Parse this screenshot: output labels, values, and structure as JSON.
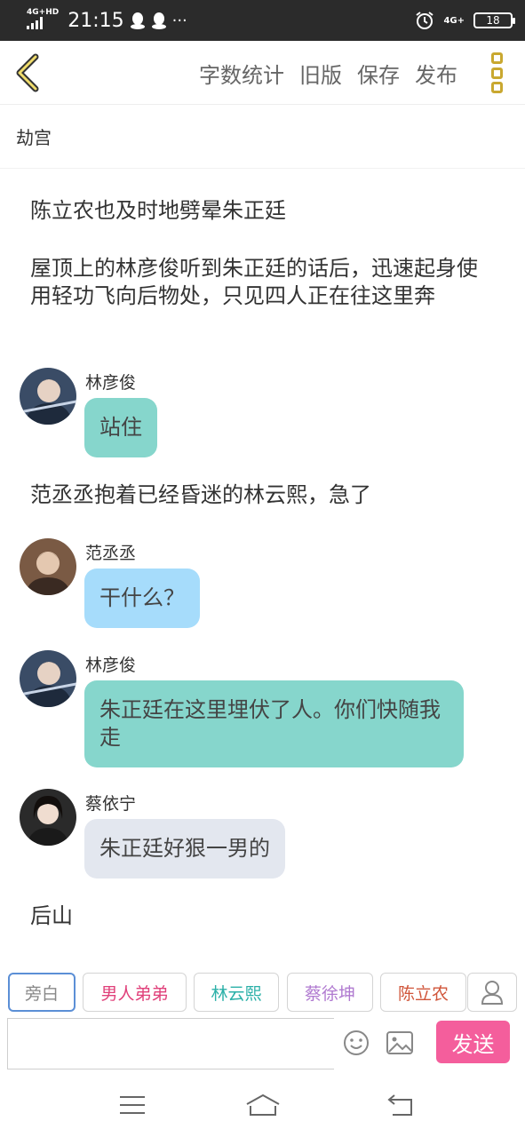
{
  "status_bar": {
    "network": "4G+HD",
    "time": "21:15",
    "signal": "4G+",
    "battery": "18",
    "more": "···"
  },
  "toolbar": {
    "items": [
      "字数统计",
      "旧版",
      "保存",
      "发布"
    ]
  },
  "title": "劫宫",
  "messages": [
    {
      "type": "narration",
      "text": "陈立农也及时地劈晕朱正廷"
    },
    {
      "type": "narration",
      "text": "屋顶上的林彦俊听到朱正廷的话后，迅速起身使用轻功飞向后物处，只见四人正在往这里奔"
    },
    {
      "type": "dialog",
      "speaker": "林彦俊",
      "text": "站住",
      "color": "#86d6cc"
    },
    {
      "type": "narration",
      "text": "范丞丞抱着已经昏迷的林云熙，急了"
    },
    {
      "type": "dialog",
      "speaker": "范丞丞",
      "text": "干什么？",
      "color": "#a6dcfb"
    },
    {
      "type": "dialog",
      "speaker": "林彦俊",
      "text": "朱正廷在这里埋伏了人。你们快随我走",
      "color": "#86d6cc"
    },
    {
      "type": "dialog",
      "speaker": "蔡依宁",
      "text": "朱正廷好狠一男的",
      "color": "#e3e7ef"
    },
    {
      "type": "narration",
      "text": "后山"
    }
  ],
  "roles": [
    {
      "label": "旁白",
      "color": "#888888"
    },
    {
      "label": "男人弟弟",
      "color": "#e0407a"
    },
    {
      "label": "林云熙",
      "color": "#2bb0a8"
    },
    {
      "label": "蔡徐坤",
      "color": "#b07ad0"
    },
    {
      "label": "陈立农",
      "color": "#d0553a"
    }
  ],
  "composer": {
    "placeholder": "",
    "send_label": "发送"
  }
}
